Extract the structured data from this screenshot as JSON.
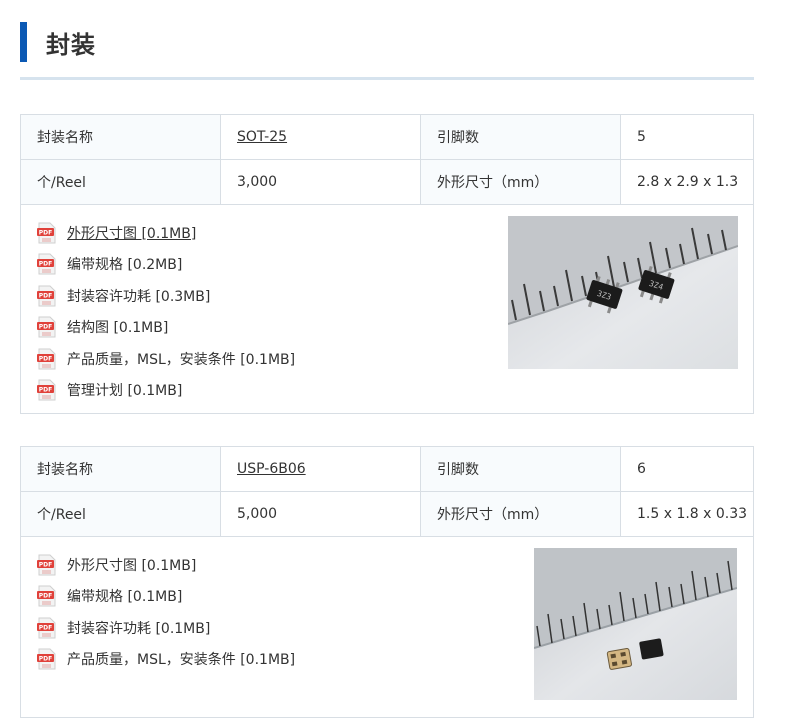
{
  "section": {
    "title": "封装"
  },
  "labels": {
    "package_name": "封装名称",
    "pin_count": "引脚数",
    "per_reel": "个/Reel",
    "dimensions": "外形尺寸（mm）"
  },
  "packages": [
    {
      "name": "SOT-25",
      "pins": "5",
      "per_reel": "3,000",
      "dimensions": "2.8 x 2.9 x 1.3",
      "docs": [
        "外形尺寸图 [0.1MB]",
        "编带规格 [0.2MB]",
        "封装容许功耗 [0.3MB]",
        "结构图 [0.1MB]",
        "产品质量，MSL，安装条件 [0.1MB]",
        "管理计划 [0.1MB]"
      ]
    },
    {
      "name": "USP-6B06",
      "pins": "6",
      "per_reel": "5,000",
      "dimensions": "1.5 x 1.8 x 0.33",
      "docs": [
        "外形尺寸图 [0.1MB]",
        "编带规格 [0.1MB]",
        "封装容许功耗 [0.1MB]",
        "产品质量，MSL，安装条件 [0.1MB]"
      ]
    }
  ],
  "icons": {
    "doc": "pdf-icon"
  },
  "colors": {
    "accent": "#0b59b4",
    "pdf_red": "#e0413a"
  }
}
